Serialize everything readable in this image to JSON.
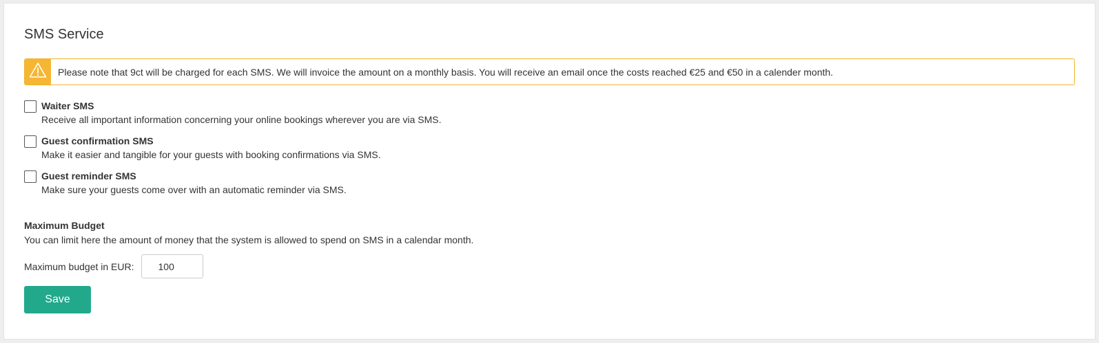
{
  "panel": {
    "title": "SMS Service"
  },
  "alert": {
    "icon": "warning-icon",
    "text": "Please note that 9ct will be charged for each SMS. We will invoice the amount on a monthly basis. You will receive an email once the costs reached €25 and €50 in a calender month."
  },
  "options": [
    {
      "label": "Waiter SMS",
      "description": "Receive all important information concerning your online bookings wherever you are via SMS.",
      "checked": false
    },
    {
      "label": "Guest confirmation SMS",
      "description": "Make it easier and tangible for your guests with booking confirmations via SMS.",
      "checked": false
    },
    {
      "label": "Guest reminder SMS",
      "description": "Make sure your guests come over with an automatic reminder via SMS.",
      "checked": false
    }
  ],
  "budget": {
    "heading": "Maximum Budget",
    "description": "You can limit here the amount of money that the system is allowed to spend on SMS in a calendar month.",
    "field_label": "Maximum budget in EUR:",
    "value": "100"
  },
  "actions": {
    "save_label": "Save"
  },
  "colors": {
    "accent": "#22a98b",
    "warning": "#f5b633"
  }
}
